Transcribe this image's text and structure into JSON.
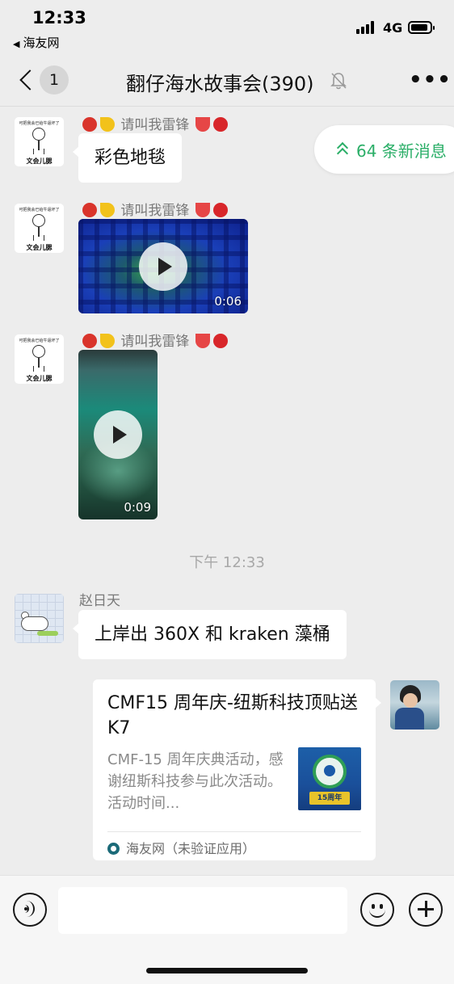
{
  "status_bar": {
    "time": "12:33",
    "back_app": "海友网",
    "network": "4G"
  },
  "nav": {
    "unread_badge": "1",
    "title": "翻仔海水故事会(390)",
    "more": "•••"
  },
  "new_messages_pill": {
    "label": "64 条新消息"
  },
  "avatars": {
    "meme_caption_top": "可把我会已给牛逼坏了",
    "meme_caption_bottom": "文会儿腮"
  },
  "messages": [
    {
      "sender": "请叫我雷锋",
      "type": "text",
      "text": "彩色地毯"
    },
    {
      "sender": "请叫我雷锋",
      "type": "video",
      "duration": "0:06"
    },
    {
      "sender": "请叫我雷锋",
      "type": "video",
      "duration": "0:09"
    }
  ],
  "timestamp": "下午 12:33",
  "message_zhao": {
    "sender": "赵日天",
    "text": "上岸出 360X 和 kraken 藻桶"
  },
  "share_card": {
    "title": "CMF15 周年庆-纽斯科技顶贴送 K7",
    "description": "CMF-15 周年庆典活动，感谢纽斯科技参与此次活动。活动时间...",
    "thumb_label": "15周年",
    "source": "海友网（未验证应用）"
  },
  "colors": {
    "background": "#ededed",
    "accent_green": "#2aae67",
    "bubble": "#ffffff"
  },
  "icons": [
    "back-chevron-icon",
    "mute-bell-icon",
    "more-icon",
    "voice-icon",
    "emoji-icon",
    "plus-icon",
    "play-icon",
    "double-chevron-up-icon"
  ]
}
